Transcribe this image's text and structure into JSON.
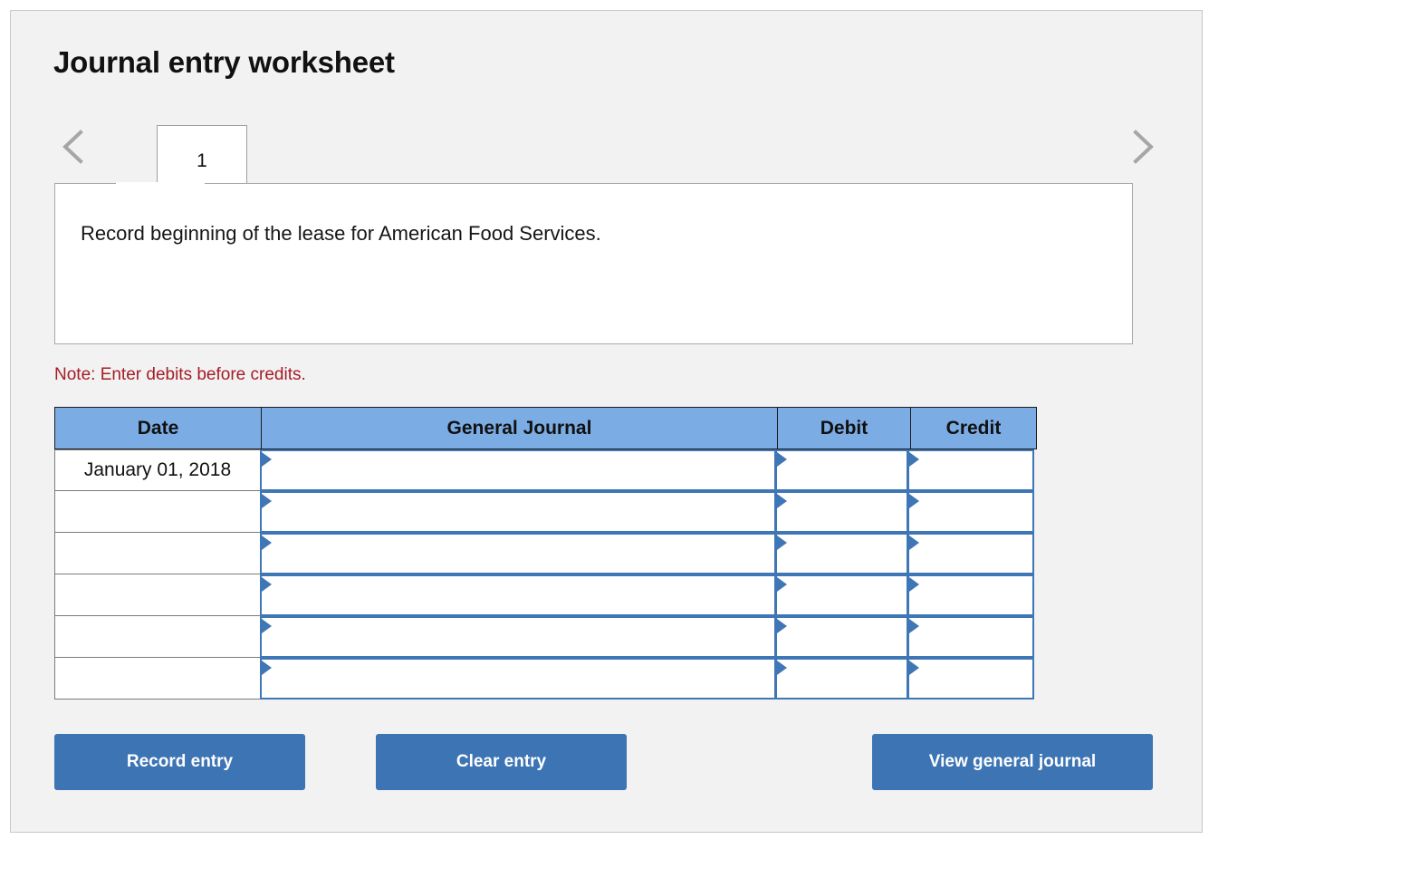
{
  "header": {
    "title": "Journal entry worksheet"
  },
  "tabs": {
    "prev_icon": "chevron-left-icon",
    "next_icon": "chevron-right-icon",
    "items": [
      {
        "label": "1",
        "active": true
      }
    ]
  },
  "description": {
    "text": "Record beginning of the lease for American Food Services."
  },
  "note": {
    "text": "Note: Enter debits before credits."
  },
  "table": {
    "columns": [
      "Date",
      "General Journal",
      "Debit",
      "Credit"
    ],
    "rows": [
      {
        "date": "January 01, 2018",
        "general_journal": "",
        "debit": "",
        "credit": ""
      },
      {
        "date": "",
        "general_journal": "",
        "debit": "",
        "credit": ""
      },
      {
        "date": "",
        "general_journal": "",
        "debit": "",
        "credit": ""
      },
      {
        "date": "",
        "general_journal": "",
        "debit": "",
        "credit": ""
      },
      {
        "date": "",
        "general_journal": "",
        "debit": "",
        "credit": ""
      },
      {
        "date": "",
        "general_journal": "",
        "debit": "",
        "credit": ""
      }
    ]
  },
  "actions": {
    "record_label": "Record entry",
    "clear_label": "Clear entry",
    "view_label": "View general journal"
  },
  "colors": {
    "header_blue": "#7bace4",
    "button_blue": "#3c74b4",
    "input_border_blue": "#3f76b5",
    "note_red": "#a51c26",
    "panel_bg": "#f2f2f2"
  }
}
